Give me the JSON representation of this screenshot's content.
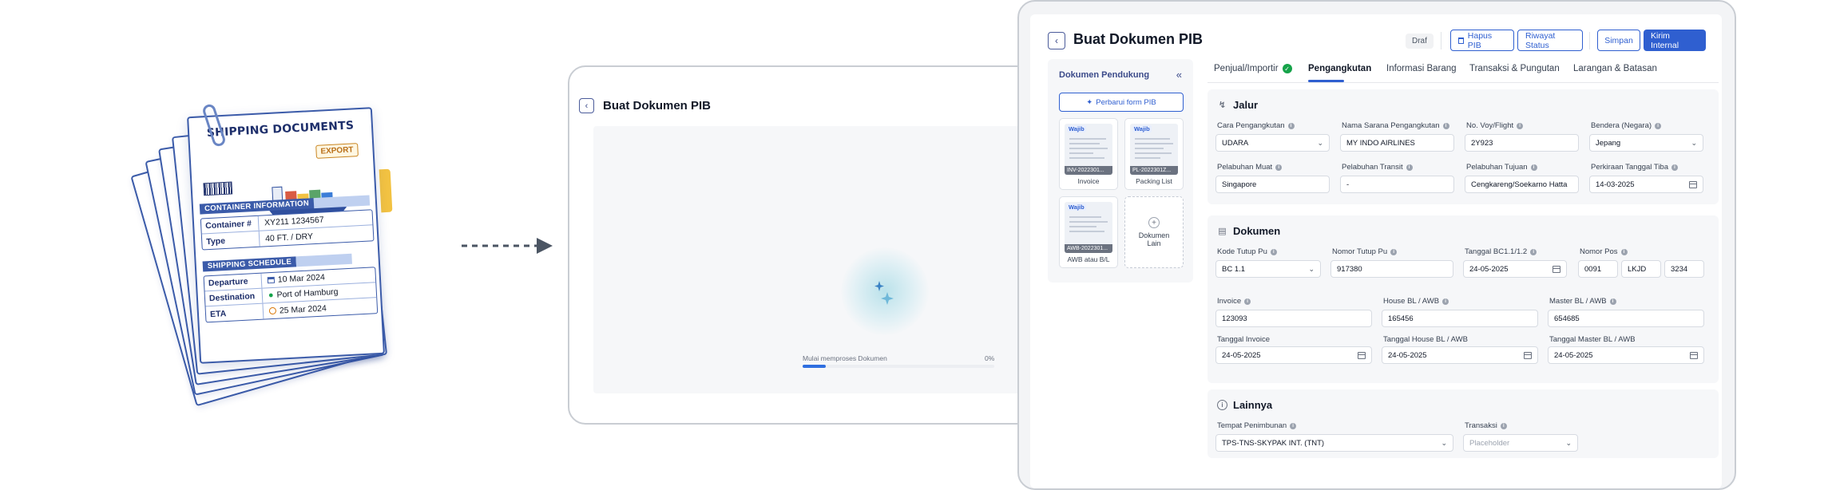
{
  "illustration": {
    "title": "SHIPPING DOCUMENTS",
    "badge": "EXPORT",
    "container_section": "CONTAINER INFORMATION",
    "container_rows": [
      {
        "key": "Container #",
        "value": "XY211 1234567"
      },
      {
        "key": "Type",
        "value": "40 FT. / DRY"
      }
    ],
    "schedule_section": "SHIPPING SCHEDULE",
    "schedule_rows": [
      {
        "key": "Departure",
        "value": "10 Mar 2024",
        "icon": "calendar-icon"
      },
      {
        "key": "Destination",
        "value": "Port of Hamburg",
        "icon": "location-pin-icon"
      },
      {
        "key": "ETA",
        "value": "25 Mar 2024",
        "icon": "clock-icon"
      }
    ]
  },
  "middle": {
    "title": "Buat Dokumen PIB",
    "loading_label": "Mulai memproses Dokumen",
    "loading_percent": "0%",
    "progress": 0.12
  },
  "right": {
    "title": "Buat Dokumen PIB",
    "status_badge": "Draf",
    "buttons": {
      "hapus": "Hapus PIB",
      "riwayat": "Riwayat Status",
      "simpan": "Simpan",
      "kirim": "Kirim Internal"
    },
    "sidebar": {
      "title": "Dokumen Pendukung",
      "refresh_button": "Perbarui form PIB",
      "required_tag": "Wajib",
      "docs": [
        {
          "code": "INV-2022301...",
          "label": "Invoice"
        },
        {
          "code": "PL-2022301Z...",
          "label": "Packing List"
        },
        {
          "code": "AWB-2022301...",
          "label": "AWB atau B/L"
        }
      ],
      "add_label": "Dokumen Lain"
    },
    "tabs": [
      "Penjual/Importir",
      "Pengangkutan",
      "Informasi Barang",
      "Transaksi & Pungutan",
      "Larangan & Batasan"
    ],
    "active_tab": "Pengangkutan",
    "jalur": {
      "title": "Jalur",
      "cara_label": "Cara Pengangkutan",
      "cara_value": "UDARA",
      "sarana_label": "Nama Sarana Pengangkutan",
      "sarana_value": "MY INDO AIRLINES",
      "voy_label": "No. Voy/Flight",
      "voy_value": "2Y923",
      "bendera_label": "Bendera (Negara)",
      "bendera_value": "Jepang",
      "muat_label": "Pelabuhan Muat",
      "muat_value": "Singapore",
      "transit_label": "Pelabuhan Transit",
      "transit_value": "-",
      "tujuan_label": "Pelabuhan Tujuan",
      "tujuan_value": "Cengkareng/Soekarno Hatta",
      "tiba_label": "Perkiraan Tanggal Tiba",
      "tiba_value": "14-03-2025"
    },
    "dokumen": {
      "title": "Dokumen",
      "kode_label": "Kode Tutup Pu",
      "kode_value": "BC 1.1",
      "nomor_label": "Nomor Tutup Pu",
      "nomor_value": "917380",
      "tgl_bc_label": "Tanggal BC1.1/1.2",
      "tgl_bc_value": "24-05-2025",
      "pos_label": "Nomor Pos",
      "pos_values": [
        "0091",
        "LKJD",
        "3234"
      ],
      "invoice_label": "Invoice",
      "invoice_value": "123093",
      "house_label": "House BL / AWB",
      "house_value": "165456",
      "master_label": "Master BL / AWB",
      "master_value": "654685",
      "tgl_inv_label": "Tanggal Invoice",
      "tgl_inv_value": "24-05-2025",
      "tgl_house_label": "Tanggal House BL / AWB",
      "tgl_house_value": "24-05-2025",
      "tgl_master_label": "Tanggal Master BL / AWB",
      "tgl_master_value": "24-05-2025"
    },
    "lainnya": {
      "title": "Lainnya",
      "tempat_label": "Tempat Penimbunan",
      "tempat_value": "TPS-TNS-SKYPAK INT. (TNT)",
      "transaksi_label": "Transaksi",
      "transaksi_placeholder": "Placeholder"
    }
  }
}
